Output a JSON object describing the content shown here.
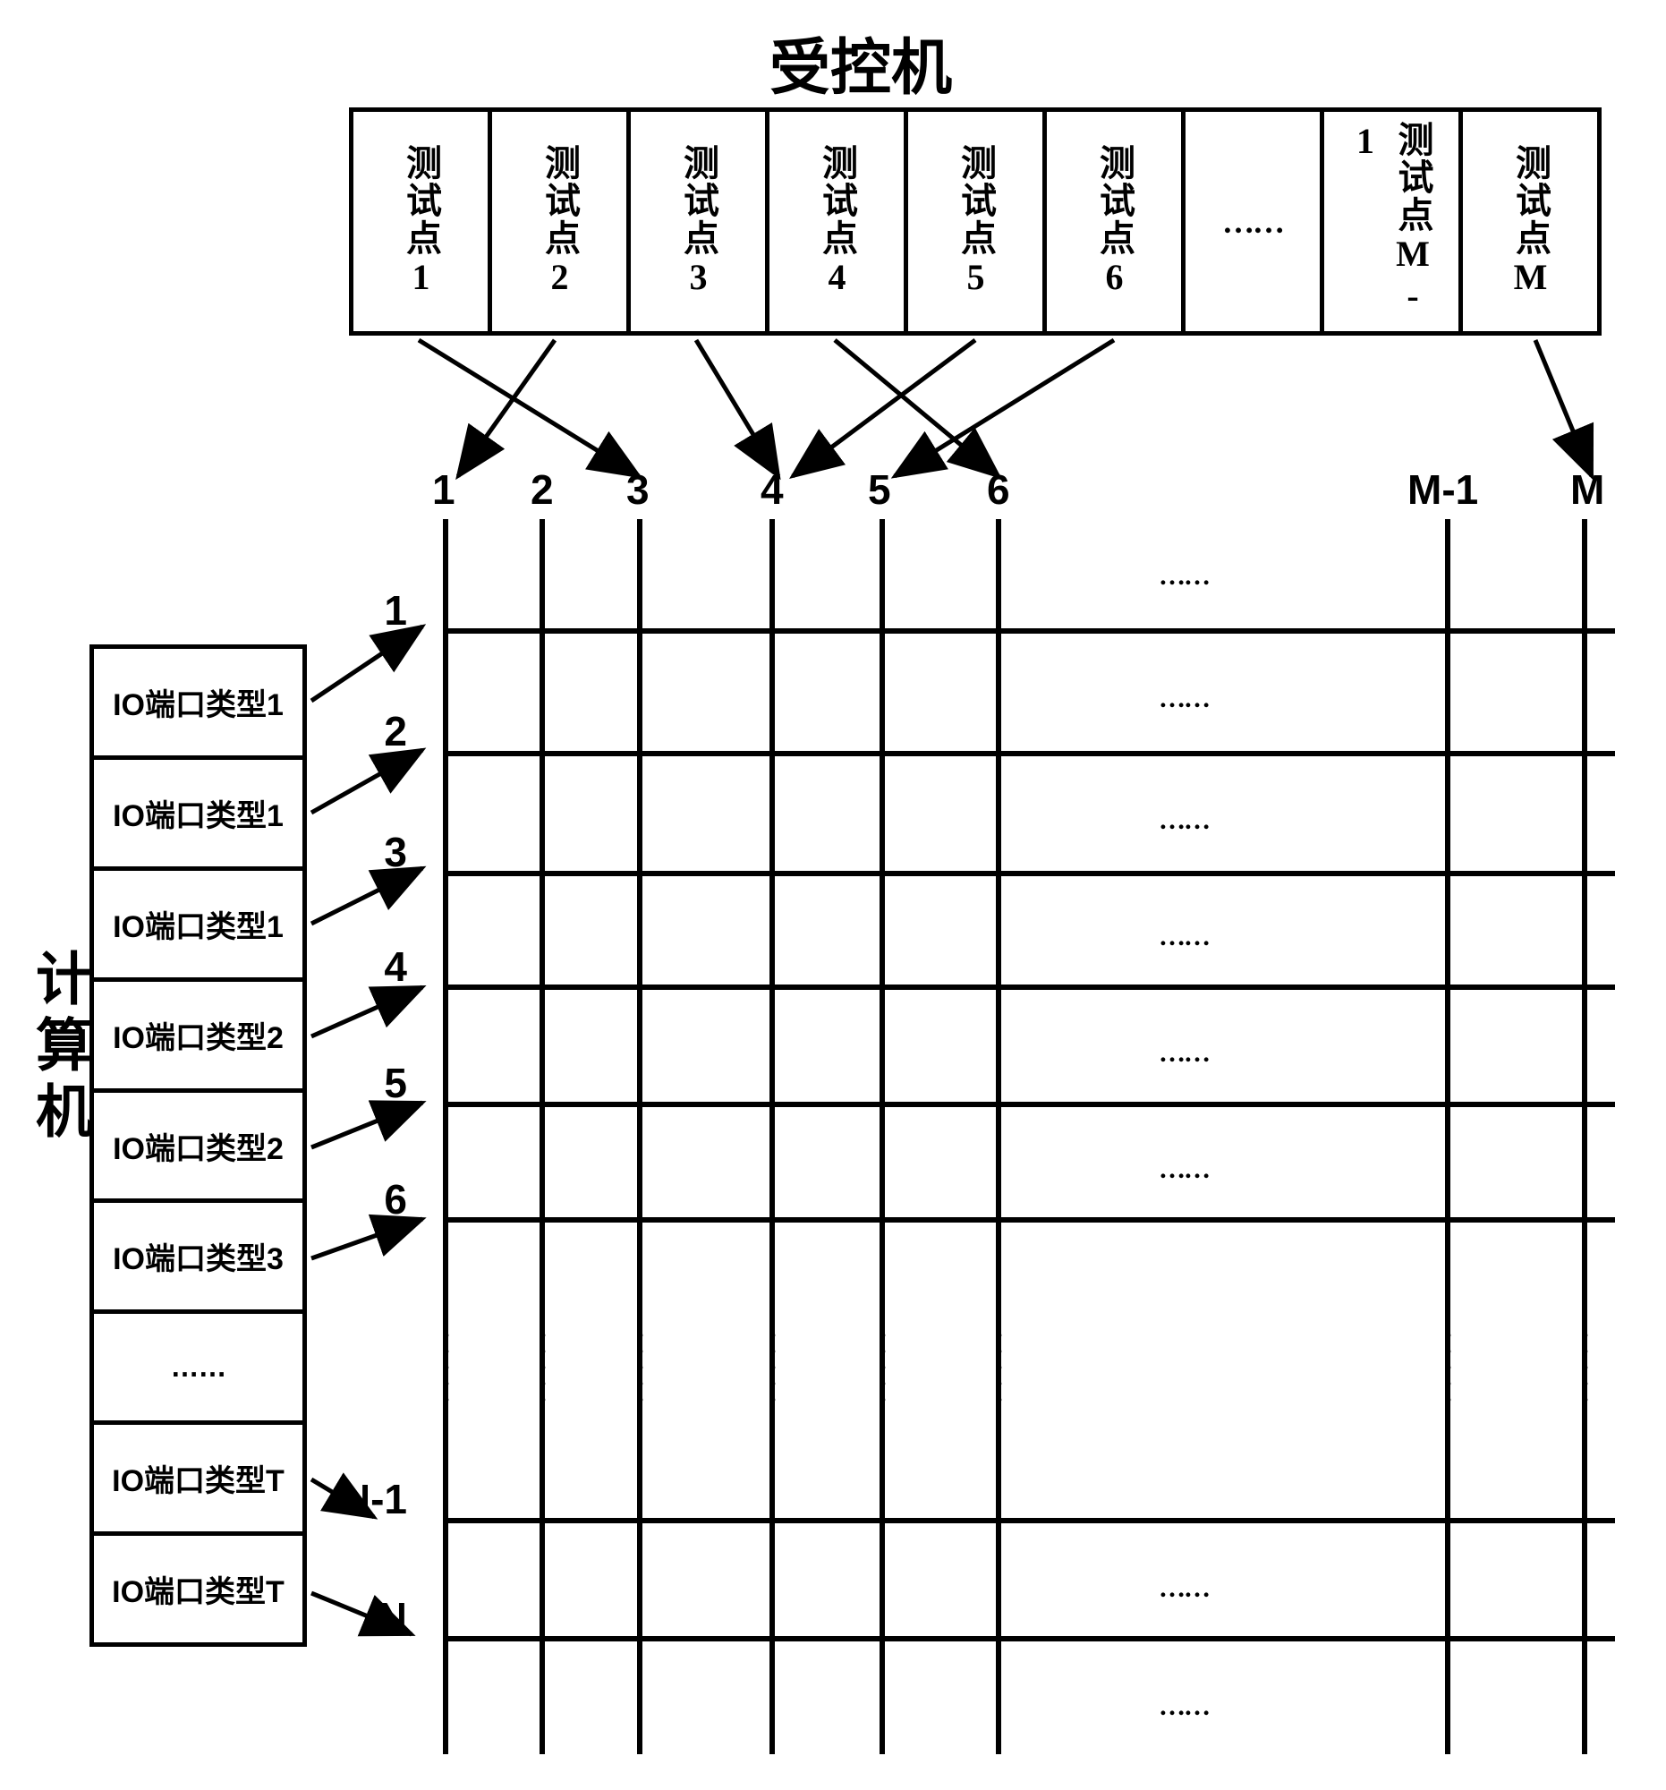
{
  "top_title": "受控机",
  "left_title": "计算机",
  "controlled_cells": {
    "c1": "测试点1",
    "c2": "测试点2",
    "c3": "测试点3",
    "c4": "测试点4",
    "c5": "测试点5",
    "c6": "测试点6",
    "c7": "……",
    "c8": "测试点M-1",
    "c9": "测试点M"
  },
  "computer_cells": {
    "r1": "IO端口类型1",
    "r2": "IO端口类型1",
    "r3": "IO端口类型1",
    "r4": "IO端口类型2",
    "r5": "IO端口类型2",
    "r6": "IO端口类型3",
    "r7": "……",
    "r8": "IO端口类型T",
    "r9": "IO端口类型T"
  },
  "col_labels": {
    "c1": "1",
    "c2": "2",
    "c3": "3",
    "c4": "4",
    "c5": "5",
    "c6": "6",
    "cM1": "M-1",
    "cM": "M"
  },
  "row_labels": {
    "r1": "1",
    "r2": "2",
    "r3": "3",
    "r4": "4",
    "r5": "5",
    "r6": "6",
    "rN1": "N-1",
    "rN": "N"
  },
  "ellipsis": "……",
  "vellipsis": "●●●●●"
}
